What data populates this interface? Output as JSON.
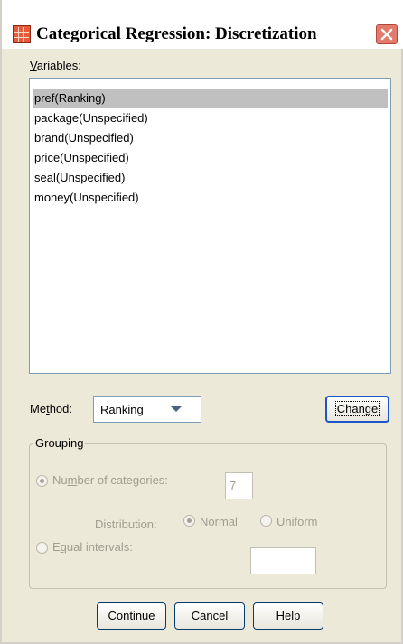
{
  "window": {
    "title": "Categorical Regression: Discretization",
    "title_icon": "grid-table-icon",
    "close_icon": "close-icon"
  },
  "variables": {
    "label_underline": "V",
    "label_rest": "ariables:",
    "items": [
      "pref(Ranking)",
      "package(Unspecified)",
      "brand(Unspecified)",
      "price(Unspecified)",
      "seal(Unspecified)",
      "money(Unspecified)"
    ],
    "selected_index": 0
  },
  "method": {
    "label_a": "Me",
    "label_u": "t",
    "label_b": "hod:",
    "value": "Ranking",
    "change_label": "Change"
  },
  "grouping": {
    "legend": "Grouping",
    "num_cat_a": "Nu",
    "num_cat_u": "m",
    "num_cat_b": "ber of categories:",
    "num_cat_value": "7",
    "distribution_label": "Distribution:",
    "normal_u": "N",
    "normal_rest": "ormal",
    "uniform_u": "U",
    "uniform_rest": "niform",
    "equal_a": "E",
    "equal_u": "q",
    "equal_b": "ual intervals:",
    "equal_value": ""
  },
  "buttons": {
    "continue": "Continue",
    "cancel": "Cancel",
    "help": "Help"
  },
  "colors": {
    "dialog_bg": "#ece9d8",
    "selection": "#c0c0c0",
    "disabled_text": "#a19d91",
    "button_border": "#003c74"
  }
}
